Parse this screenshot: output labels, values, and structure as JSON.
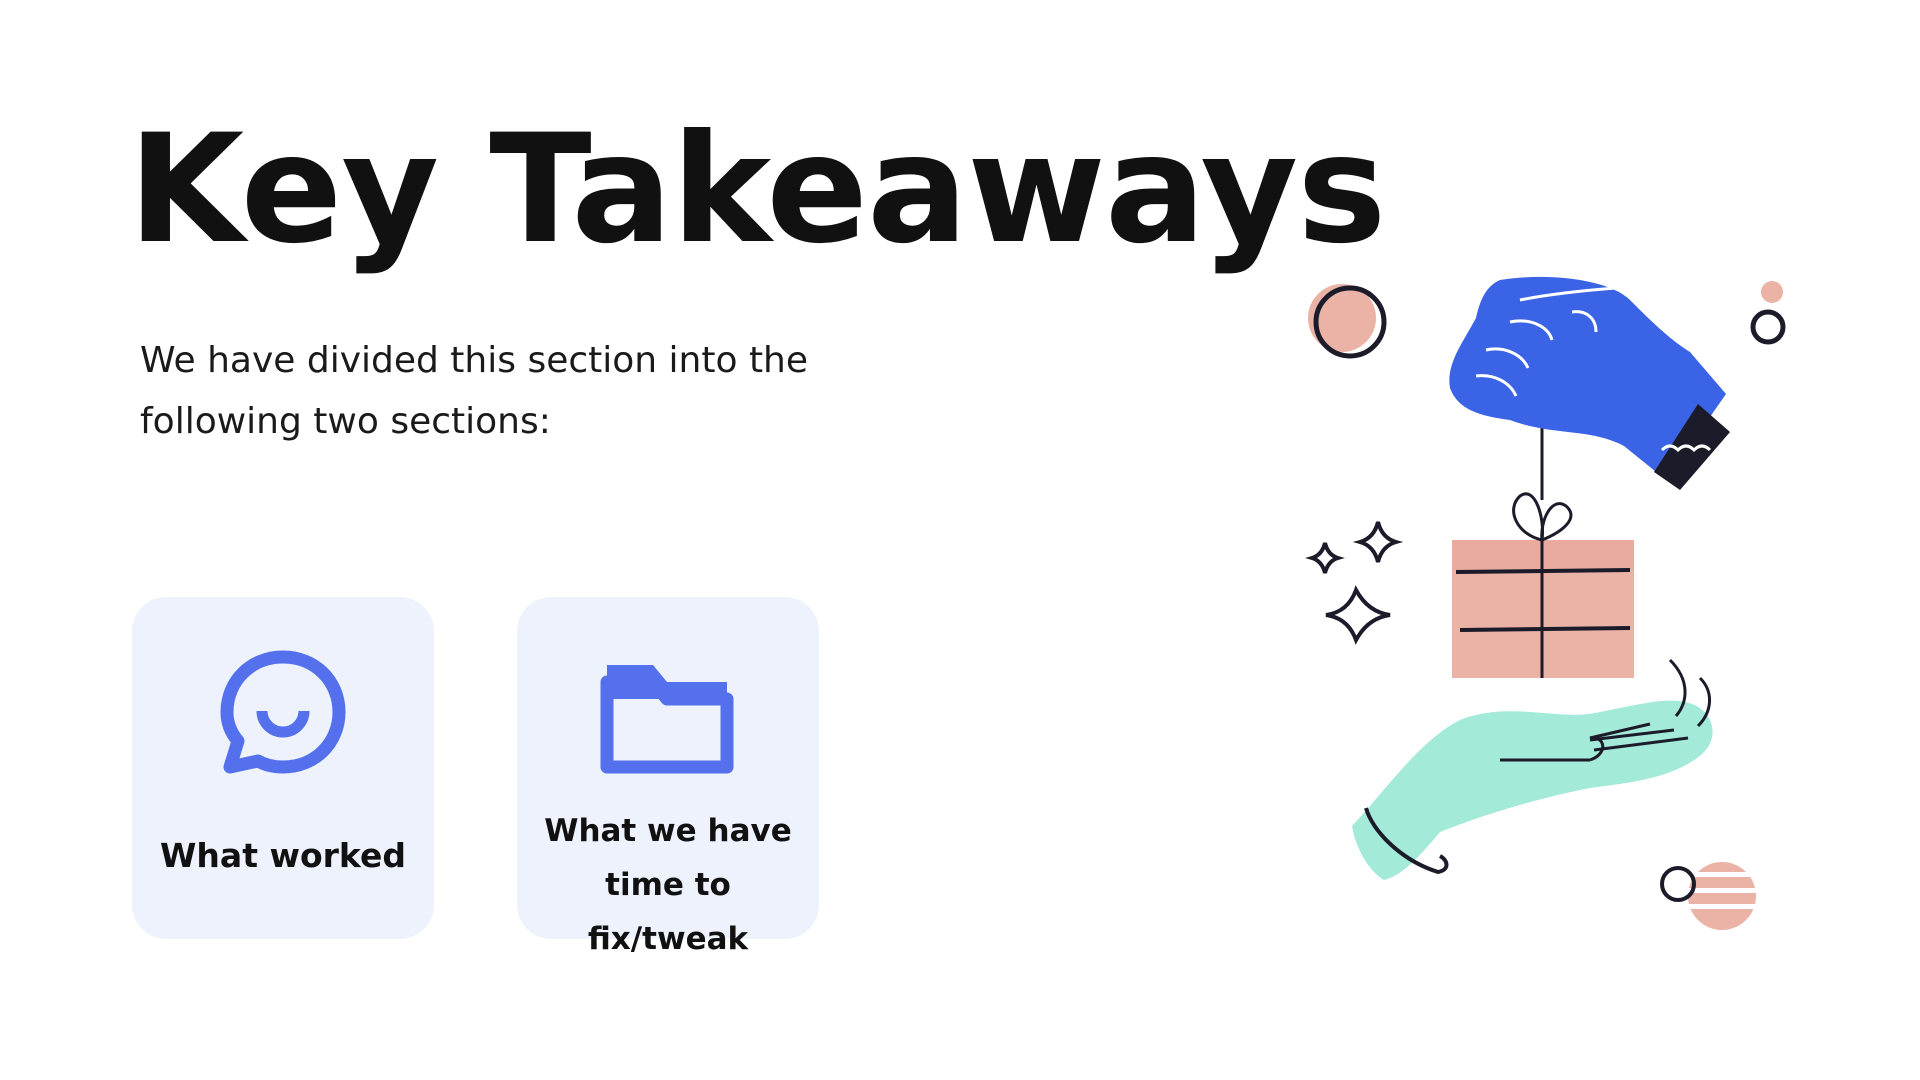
{
  "slide": {
    "title": "Key Takeaways",
    "subtitle": "We have divided this section into the following two sections:"
  },
  "cards": [
    {
      "label": "What worked",
      "icon": "chat-smile-icon"
    },
    {
      "label": "What we have time to fix/tweak",
      "icon": "folder-icon"
    }
  ],
  "illustration": {
    "icon": "gift-handover-illustration"
  },
  "colors": {
    "card_bg": "#eef2fc",
    "icon_blue": "#5470ec",
    "hand_blue": "#3b63e6",
    "hand_mint": "#a3ead8",
    "gift_peach": "#ebb3a6"
  }
}
